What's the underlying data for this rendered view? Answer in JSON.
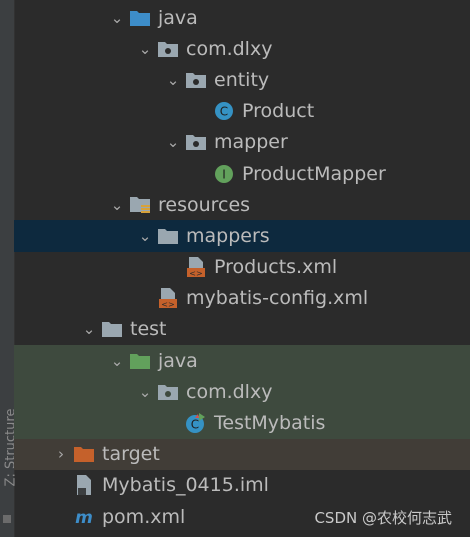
{
  "sidebar": {
    "label": "Z: Structure"
  },
  "tree": {
    "rows": [
      {
        "label": "java",
        "icon": "folder-src-icon",
        "expanded": true
      },
      {
        "label": "com.dlxy",
        "icon": "package-icon",
        "expanded": true
      },
      {
        "label": "entity",
        "icon": "package-icon",
        "expanded": true
      },
      {
        "label": "Product",
        "icon": "class-icon"
      },
      {
        "label": "mapper",
        "icon": "package-icon",
        "expanded": true
      },
      {
        "label": "ProductMapper",
        "icon": "interface-icon"
      },
      {
        "label": "resources",
        "icon": "folder-resources-icon",
        "expanded": true
      },
      {
        "label": "mappers",
        "icon": "folder-icon",
        "expanded": true,
        "selected": true
      },
      {
        "label": "Products.xml",
        "icon": "xml-file-icon"
      },
      {
        "label": "mybatis-config.xml",
        "icon": "xml-file-icon"
      },
      {
        "label": "test",
        "icon": "folder-icon",
        "expanded": true
      },
      {
        "label": "java",
        "icon": "folder-test-icon",
        "expanded": true
      },
      {
        "label": "com.dlxy",
        "icon": "package-icon",
        "expanded": true
      },
      {
        "label": "TestMybatis",
        "icon": "test-class-icon"
      },
      {
        "label": "target",
        "icon": "folder-excluded-icon",
        "expanded": false
      },
      {
        "label": "Mybatis_0415.iml",
        "icon": "iml-file-icon"
      },
      {
        "label": "pom.xml",
        "icon": "maven-icon"
      }
    ]
  },
  "watermark": "CSDN @农校何志武",
  "colors": {
    "background": "#2b2b2b",
    "selected": "#0d293e",
    "test_source": "#3e4a3e",
    "excluded": "#413d37",
    "src_folder": "#3d8dc9",
    "test_folder": "#62a15c",
    "excluded_folder": "#c5612b"
  }
}
